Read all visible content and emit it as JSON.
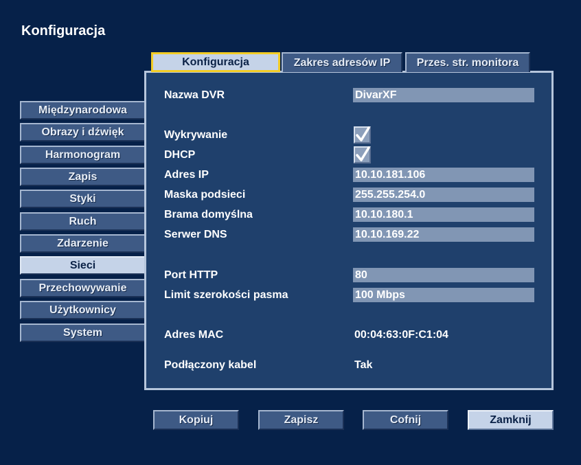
{
  "page": {
    "title": "Konfiguracja"
  },
  "tabs": [
    {
      "label": "Konfiguracja",
      "active": true
    },
    {
      "label": "Zakres adresów IP",
      "active": false
    },
    {
      "label": "Przes. str. monitora",
      "active": false
    }
  ],
  "sidebar": {
    "items": [
      {
        "label": "Międzynarodowa"
      },
      {
        "label": "Obrazy i dźwięk"
      },
      {
        "label": "Harmonogram"
      },
      {
        "label": "Zapis"
      },
      {
        "label": "Styki"
      },
      {
        "label": "Ruch"
      },
      {
        "label": "Zdarzenie"
      },
      {
        "label": "Sieci",
        "active": true
      },
      {
        "label": "Przechowywanie"
      },
      {
        "label": "Użytkownicy"
      },
      {
        "label": "System"
      }
    ]
  },
  "form": {
    "dvr_name": {
      "label": "Nazwa DVR",
      "value": "DivarXF"
    },
    "discovery": {
      "label": "Wykrywanie",
      "checked": true
    },
    "dhcp": {
      "label": "DHCP",
      "checked": true
    },
    "ip_address": {
      "label": "Adres IP",
      "value": "10.10.181.106"
    },
    "subnet_mask": {
      "label": "Maska podsieci",
      "value": "255.255.254.0"
    },
    "default_gateway": {
      "label": "Brama domyślna",
      "value": "10.10.180.1"
    },
    "dns_server": {
      "label": "Serwer DNS",
      "value": "10.10.169.22"
    },
    "http_port": {
      "label": "Port HTTP",
      "value": "80"
    },
    "bandwidth_limit": {
      "label": "Limit szerokości pasma",
      "value": "100 Mbps"
    },
    "mac_address": {
      "label": "Adres MAC",
      "value": "00:04:63:0F:C1:04"
    },
    "cable_connected": {
      "label": "Podłączony kabel",
      "value": "Tak"
    }
  },
  "buttons": {
    "copy": "Kopiuj",
    "save": "Zapisz",
    "undo": "Cofnij",
    "close": "Zamknij"
  },
  "colors": {
    "background": "#062149",
    "panel": "#1f406c",
    "active_tab_border": "#f2cc25",
    "field": "#8196b4"
  }
}
